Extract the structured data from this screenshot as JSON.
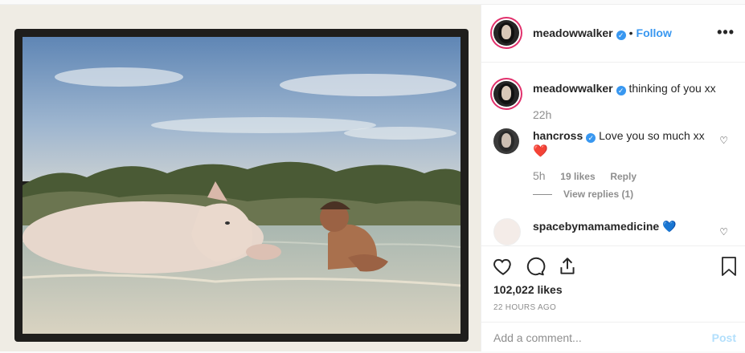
{
  "post": {
    "author": "meadowwalker",
    "follow_label": "Follow",
    "separator": "•",
    "more_label": "•••"
  },
  "caption": {
    "author": "meadowwalker",
    "text": "thinking of you xx",
    "time": "22h"
  },
  "comments": [
    {
      "author": "hancross",
      "text": "Love you so much xx",
      "emoji": "❤️",
      "time": "5h",
      "likes": "19 likes",
      "reply_label": "Reply",
      "view_replies": "View replies (1)"
    },
    {
      "author": "spacebymamamedicine",
      "emoji": "💙"
    }
  ],
  "engagement": {
    "likes": "102,022 likes",
    "timestamp": "22 HOURS AGO"
  },
  "comment_box": {
    "placeholder": "Add a comment...",
    "post_label": "Post"
  },
  "icons": {
    "like": "heart-outline-icon",
    "comment": "comment-bubble-icon",
    "share": "share-icon",
    "save": "bookmark-icon",
    "verified": "verified-badge-icon"
  },
  "colors": {
    "link": "#3897f0",
    "post_disabled": "#b2dffc",
    "verified": "#3897f0"
  }
}
